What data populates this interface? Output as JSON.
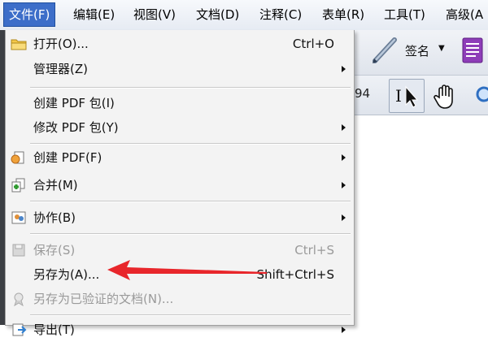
{
  "menubar": {
    "items": [
      {
        "label": "文件(F)"
      },
      {
        "label": "编辑(E)"
      },
      {
        "label": "视图(V)"
      },
      {
        "label": "文档(D)"
      },
      {
        "label": "注释(C)"
      },
      {
        "label": "表单(R)"
      },
      {
        "label": "工具(T)"
      },
      {
        "label": "高级(A"
      }
    ]
  },
  "toolbar": {
    "sign_label": "签名",
    "page_fragment": "94"
  },
  "file_menu": {
    "items": [
      {
        "label": "打开(O)...",
        "shortcut": "Ctrl+O",
        "icon": "folder-icon"
      },
      {
        "label": "管理器(Z)",
        "submenu": true
      },
      {
        "label": "创建 PDF 包(I)"
      },
      {
        "label": "修改 PDF 包(Y)",
        "submenu": true
      },
      {
        "label": "创建 PDF(F)",
        "submenu": true,
        "icon": "create-pdf-icon"
      },
      {
        "label": "合并(M)",
        "submenu": true,
        "icon": "combine-icon"
      },
      {
        "label": "协作(B)",
        "submenu": true,
        "icon": "collaborate-icon"
      },
      {
        "label": "保存(S)",
        "shortcut": "Ctrl+S",
        "disabled": true,
        "icon": "save-icon"
      },
      {
        "label": "另存为(A)...",
        "shortcut": "Shift+Ctrl+S"
      },
      {
        "label": "另存为已验证的文档(N)...",
        "disabled": true,
        "icon": "certify-icon"
      },
      {
        "label": "导出(T)",
        "submenu": true,
        "icon": "export-icon"
      }
    ]
  },
  "colors": {
    "menu_highlight": "#3d6ec9",
    "annotation_arrow": "#e8262b"
  }
}
